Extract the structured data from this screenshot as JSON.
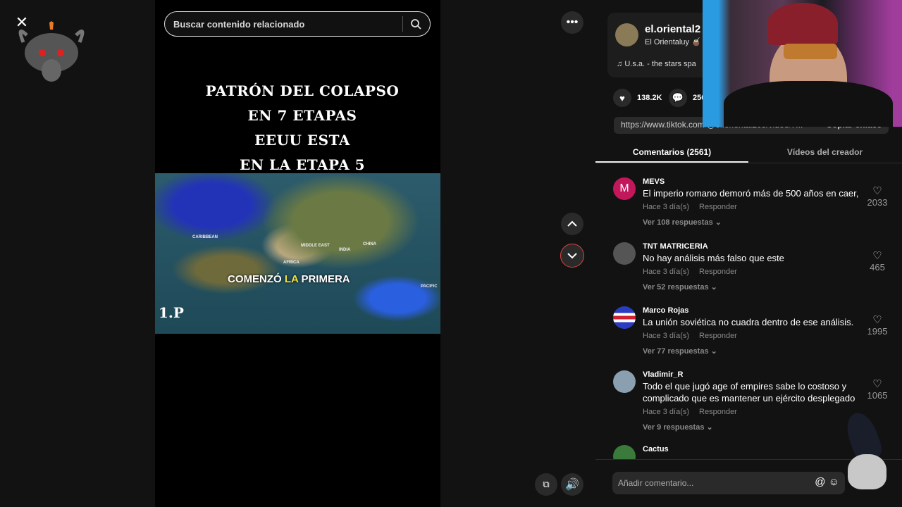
{
  "search": {
    "placeholder": "Buscar contenido relacionado"
  },
  "video": {
    "title_lines": [
      "PATRÓN DEL COLAPSO",
      "EN 7 ETAPAS",
      "EEUU ESTA",
      "EN LA ETAPA 5"
    ],
    "caption_a": "COMENZÓ ",
    "caption_b": "LA",
    "caption_c": " PRIMERA",
    "watermark": "1.P",
    "map_labels": [
      "CARIBBEAN",
      "MIDDLE EAST",
      "INDIA",
      "CHINA",
      "AFRICA",
      "PACIFIC"
    ]
  },
  "author": {
    "username": "el.oriental2",
    "display": "El Orientaluy 🧉",
    "music": "U.s.a. - the stars spa"
  },
  "stats": {
    "likes": "138.2K",
    "comments": "256"
  },
  "link": {
    "url": "https://www.tiktok.com/@el.oriental209/video/7...",
    "copy": "Copiar enlace"
  },
  "tabs": [
    "Comentarios (2561)",
    "Vídeos del creador"
  ],
  "comments": [
    {
      "user": "MEVS",
      "initial": "M",
      "text": "El imperio romano demoró más de 500 años en caer,",
      "time": "Hace 3 día(s)",
      "reply": "Responder",
      "replies": "Ver 108 respuestas",
      "likes": "2033"
    },
    {
      "user": "TNT MATRICERIA",
      "text": "No hay análisis más falso que este",
      "time": "Hace 3 día(s)",
      "reply": "Responder",
      "replies": "Ver 52 respuestas",
      "likes": "465"
    },
    {
      "user": "Marco Rojas",
      "text": "La unión soviética no cuadra dentro de ese análisis.",
      "time": "Hace 3 día(s)",
      "reply": "Responder",
      "replies": "Ver 77 respuestas",
      "likes": "1995"
    },
    {
      "user": "Vladimir_R",
      "text": "Todo el que jugó age of empires sabe lo costoso y complicado que es mantener un ejército desplegado",
      "time": "Hace 3 día(s)",
      "reply": "Responder",
      "replies": "Ver 9 respuestas",
      "likes": "1065"
    },
    {
      "user": "Cactus"
    }
  ],
  "add_comment": {
    "placeholder": "Añadir comentario..."
  },
  "colors": {
    "accent_red": "#e0443c",
    "mevs_avatar": "#c2185b"
  }
}
